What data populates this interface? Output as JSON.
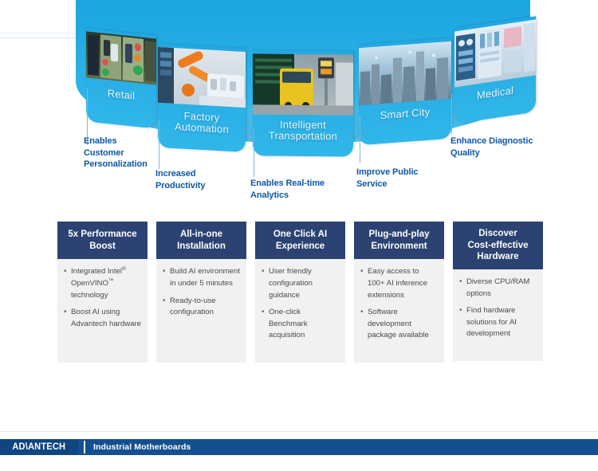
{
  "hero": {
    "panels": [
      {
        "label": "Retail",
        "callout": "Enables\nCustomer\nPersonalization",
        "callout_lines": [
          "Enables",
          "Customer",
          "Personalization"
        ]
      },
      {
        "label": "Factory\nAutomation",
        "label_lines": [
          "Factory",
          "Automation"
        ],
        "callout_lines": [
          "Increased",
          "Productivity"
        ]
      },
      {
        "label": "Intelligent\nTransportation",
        "label_lines": [
          "Intelligent",
          "Transportation"
        ],
        "callout_lines": [
          "Enables Real-time",
          "Analytics"
        ]
      },
      {
        "label": "Smart City",
        "label_lines": [
          "Smart City"
        ],
        "callout_lines": [
          "Improve Public",
          "Service"
        ]
      },
      {
        "label": "Medical",
        "label_lines": [
          "Medical"
        ],
        "callout_lines": [
          "Enhance Diagnostic",
          "Quality"
        ]
      }
    ],
    "panel_labels": [
      "Retail",
      "Factory Automation",
      "Intelligent Transportation",
      "Smart City",
      "Medical"
    ],
    "callouts": [
      "Enables Customer Personalization",
      "Increased Productivity",
      "Enables Real-time Analytics",
      "Improve Public Service",
      "Enhance Diagnostic Quality"
    ]
  },
  "cards": [
    {
      "title_lines": [
        "5x Performance",
        "Boost"
      ],
      "bullets_html": [
        "Integrated Intel<sup>®</sup> OpenVINO<sup>™</sup> technology",
        "Boost AI using Advantech hardware"
      ],
      "bullets": [
        "Integrated Intel® OpenVINO™ technology",
        "Boost AI using Advantech hardware"
      ]
    },
    {
      "title_lines": [
        "All-in-one",
        "Installation"
      ],
      "bullets": [
        "Build AI environment in under 5 minutes",
        "Ready-to-use configuration"
      ]
    },
    {
      "title_lines": [
        "One Click AI",
        "Experience"
      ],
      "bullets": [
        "User friendly configuration guidance",
        "One-click Benchmark acquisition"
      ]
    },
    {
      "title_lines": [
        "Plug-and-play",
        "Environment"
      ],
      "bullets": [
        "Easy access to 100+ AI inference extensions",
        "Software development package available"
      ]
    },
    {
      "title_lines": [
        "Discover",
        "Cost-effective",
        "Hardware"
      ],
      "bullets": [
        "Diverse CPU/RAM options",
        "Find hardware solutions for AI development"
      ]
    }
  ],
  "footer": {
    "brand": "ADVANTECH",
    "brand_pre": "AD",
    "brand_slash": "\\",
    "brand_post": "ANTECH",
    "title": "Industrial Motherboards"
  },
  "colors": {
    "card_header": "#2b4272",
    "card_body": "#f1f1f1",
    "footer_bar": "#14508f",
    "footer_logo_box": "#0f4580",
    "callout_text": "#0e57a6",
    "ribbon_blue": "#2bb2e6"
  }
}
